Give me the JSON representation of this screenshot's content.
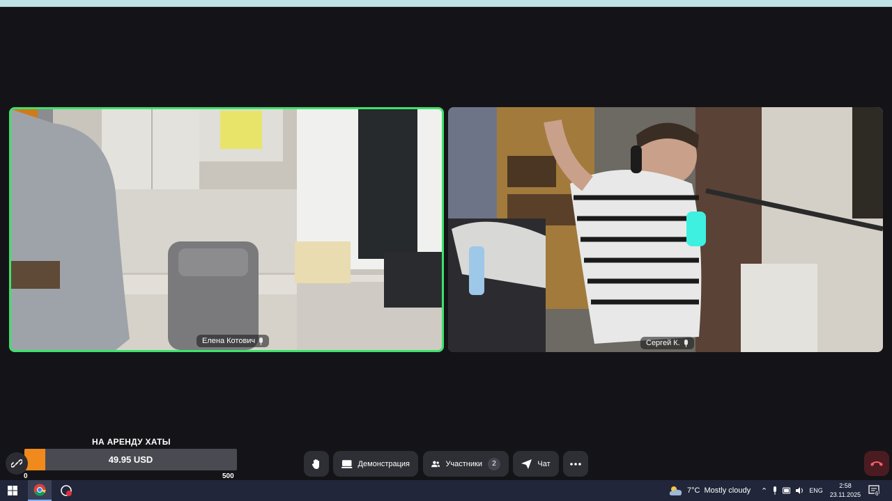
{
  "participants": [
    {
      "name": "Елена Котович",
      "active_speaker": true
    },
    {
      "name": "Сергей К.",
      "active_speaker": false
    }
  ],
  "donation": {
    "title": "НА АРЕНДУ ХАТЫ",
    "amount_text": "49.95 USD",
    "min_label": "0",
    "max_label": "500",
    "progress_fraction": 0.0999,
    "fill_color": "#f08a1c"
  },
  "toolbar": {
    "link_icon": "link-icon",
    "hand_icon": "raise-hand-icon",
    "demo_label": "Демонстрация",
    "participants_label": "Участники",
    "participants_count": "2",
    "chat_label": "Чат",
    "more_icon": "more-icon",
    "hangup_icon": "hang-up-icon"
  },
  "taskbar": {
    "weather_temp": "7°C",
    "weather_text": "Mostly cloudy",
    "language": "ENG",
    "time": "2:58",
    "date": "23.11.2025",
    "notifications": "6"
  },
  "colors": {
    "active_speaker_border": "#3de36a",
    "background": "#141418",
    "hangup": "#4a1c22"
  }
}
